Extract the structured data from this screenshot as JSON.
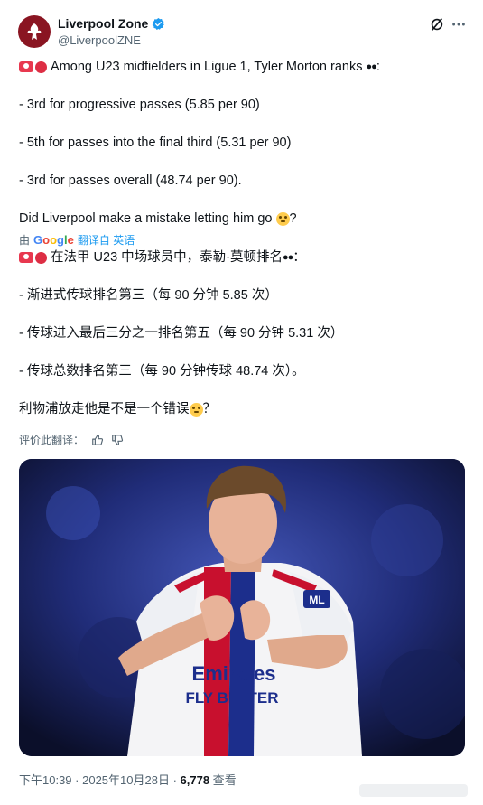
{
  "author": {
    "display_name": "Liverpool Zone",
    "handle": "@LiverpoolZNE",
    "verified": true,
    "avatar_color": "#8a1522"
  },
  "header_actions": {
    "grok_icon": "grok-icon",
    "more_icon": "more-horizontal-icon"
  },
  "tweet": {
    "line1": "Among U23 midfielders in Ligue 1, Tyler Morton ranks",
    "line1_end": ":",
    "bullet1": "- 3rd for progressive passes (5.85 per 90)",
    "bullet2": "- 5th for passes into the final third (5.31 per 90)",
    "bullet3": "- 3rd for passes overall (48.74 per 90).",
    "question": "Did Liverpool make a mistake letting him go",
    "question_end": "?"
  },
  "translation_bar": {
    "by": "由",
    "google": "Google",
    "translated_from": "翻译自 英语"
  },
  "translation": {
    "line1": "在法甲 U23 中场球员中，泰勒·莫顿排名",
    "line1_end": "：",
    "bullet1": "- 渐进式传球排名第三（每 90 分钟 5.85 次）",
    "bullet2": "- 传球进入最后三分之一排名第五（每 90 分钟 5.31 次）",
    "bullet3": "- 传球总数排名第三（每 90 分钟传球 48.74 次）。",
    "question": "利物浦放走他是不是一个错误",
    "question_end": "？"
  },
  "rate_translation": {
    "label": "评价此翻译：",
    "thumbs_up_icon": "thumbs-up-icon",
    "thumbs_down_icon": "thumbs-down-icon"
  },
  "photo": {
    "sponsor": "Emirates",
    "sponsor_line2": "FLY BETTER",
    "crest_text": "ML"
  },
  "footer": {
    "time": "下午10:39",
    "sep1": " · ",
    "date": "2025年10月28日",
    "sep2": " · ",
    "views": "6,778",
    "views_label": " 查看"
  },
  "colors": {
    "text": "#0f1419",
    "secondary": "#536471",
    "link": "#1d9bf0",
    "verified": "#1d9bf0"
  }
}
